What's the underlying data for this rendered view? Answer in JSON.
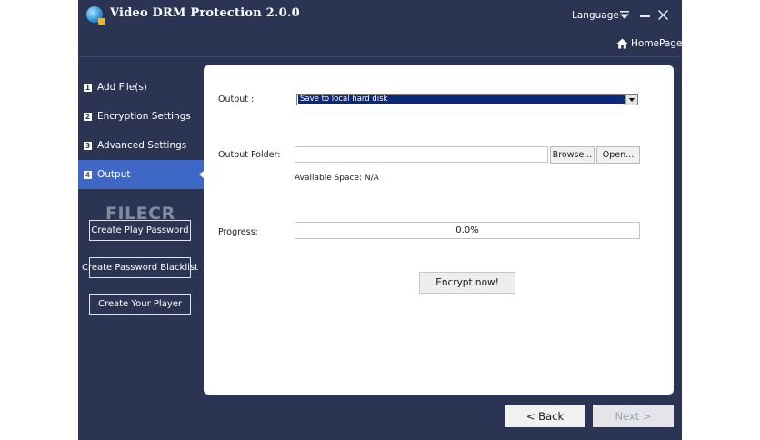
{
  "window": {
    "title": "Video DRM Protection 2.0.0",
    "language_label": "Language",
    "homepage_label": "HomePage"
  },
  "sidebar": {
    "items": [
      {
        "num": "1",
        "label": "Add File(s)"
      },
      {
        "num": "2",
        "label": "Encryption Settings"
      },
      {
        "num": "3",
        "label": "Advanced Settings"
      },
      {
        "num": "4",
        "label": "Output"
      }
    ],
    "active_index": 3,
    "buttons": {
      "play_password": "Create Play Password",
      "password_blacklist": "Create Password Blacklist",
      "your_player": "Create Your Player"
    },
    "watermark": "FILECR"
  },
  "main": {
    "output_label": "Output :",
    "output_value": "Save to local hard disk",
    "output_folder_label": "Output Folder:",
    "output_folder_value": "",
    "browse_label": "Browse...",
    "open_label": "Open...",
    "available_space": "Available Space: N/A",
    "progress_label": "Progress:",
    "progress_text": "0.0%",
    "progress_value": 0.0,
    "encrypt_label": "Encrypt now!"
  },
  "footer": {
    "back_label": "< Back",
    "next_label": "Next >"
  },
  "colors": {
    "background": "#2b3553",
    "accent": "#3e67c6",
    "panel": "#ffffff"
  },
  "icons": [
    "app-logo-icon",
    "language-dropdown-icon",
    "minimize-icon",
    "close-icon",
    "home-icon",
    "dropdown-arrow-icon"
  ]
}
